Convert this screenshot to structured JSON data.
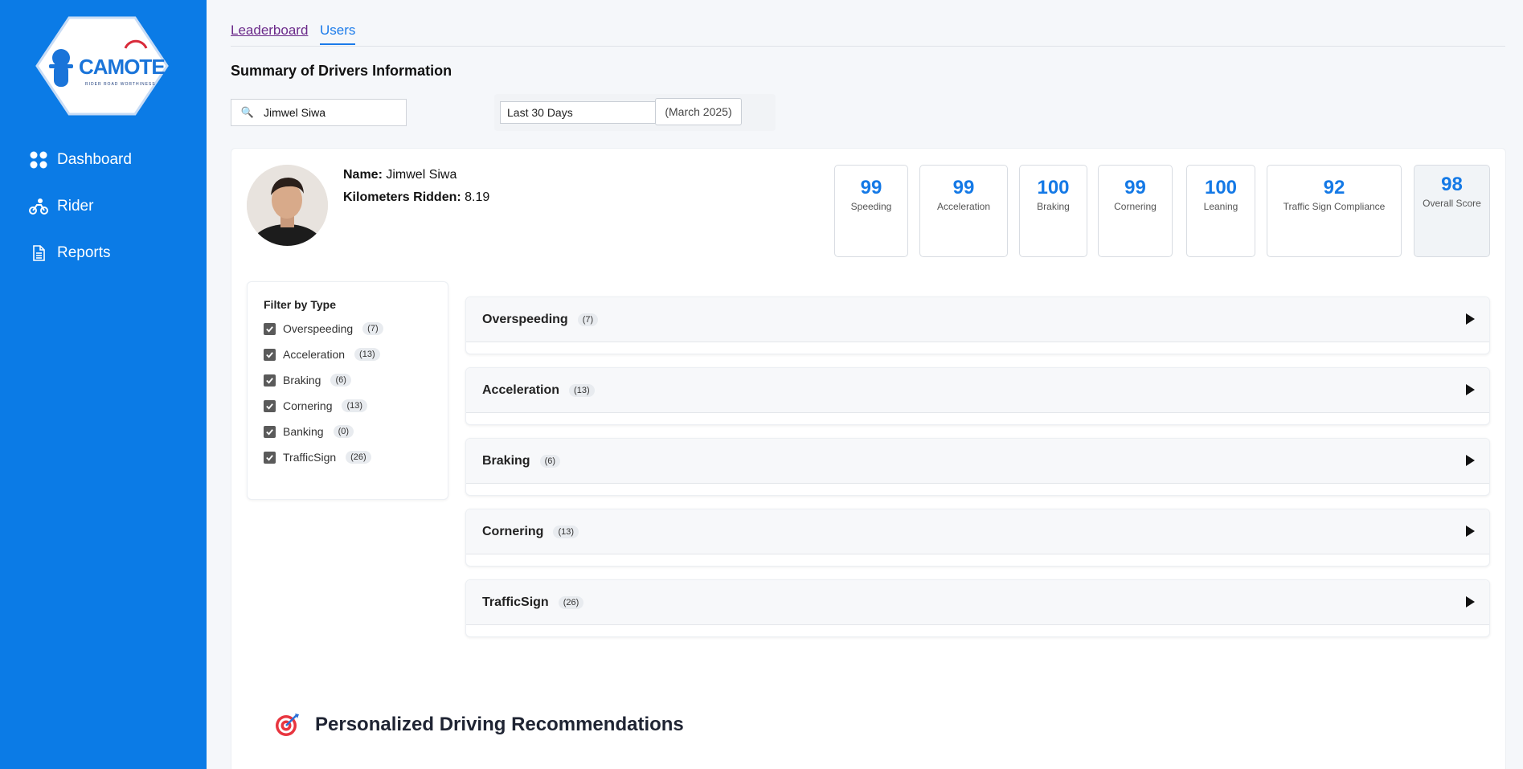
{
  "sidebar": {
    "logo_text": "CAMOTE",
    "logo_sub": "RIDER ROAD WORTHINESS",
    "items": [
      {
        "label": "Dashboard",
        "icon": "grid-icon"
      },
      {
        "label": "Rider",
        "icon": "motorbike-icon"
      },
      {
        "label": "Reports",
        "icon": "document-icon"
      }
    ]
  },
  "tabs": {
    "leaderboard": "Leaderboard",
    "users": "Users"
  },
  "page_title": "Summary of Drivers Information",
  "search": {
    "value": "Jimwel Siwa"
  },
  "date_filter": {
    "range": "Last 30 Days",
    "month": "(March 2025)"
  },
  "driver": {
    "name_label": "Name:",
    "name": "Jimwel Siwa",
    "km_label": "Kilometers Ridden:",
    "km": "8.19"
  },
  "scores": [
    {
      "value": "99",
      "label": "Speeding"
    },
    {
      "value": "99",
      "label": "Acceleration"
    },
    {
      "value": "100",
      "label": "Braking"
    },
    {
      "value": "99",
      "label": "Cornering"
    },
    {
      "value": "100",
      "label": "Leaning"
    },
    {
      "value": "92",
      "label": "Traffic Sign Compliance"
    },
    {
      "value": "98",
      "label": "Overall Score"
    }
  ],
  "filter": {
    "title": "Filter by Type",
    "items": [
      {
        "label": "Overspeeding",
        "count": "(7)",
        "checked": true
      },
      {
        "label": "Acceleration",
        "count": "(13)",
        "checked": true
      },
      {
        "label": "Braking",
        "count": "(6)",
        "checked": true
      },
      {
        "label": "Cornering",
        "count": "(13)",
        "checked": true
      },
      {
        "label": "Banking",
        "count": "(0)",
        "checked": true
      },
      {
        "label": "TrafficSign",
        "count": "(26)",
        "checked": true
      }
    ]
  },
  "sections": [
    {
      "title": "Overspeeding",
      "count": "(7)"
    },
    {
      "title": "Acceleration",
      "count": "(13)"
    },
    {
      "title": "Braking",
      "count": "(6)"
    },
    {
      "title": "Cornering",
      "count": "(13)"
    },
    {
      "title": "TrafficSign",
      "count": "(26)"
    }
  ],
  "recommendations": {
    "title": "Personalized Driving Recommendations",
    "icon": "target-icon"
  },
  "colors": {
    "sidebar": "#0b7be6",
    "accent": "#1479e6"
  }
}
